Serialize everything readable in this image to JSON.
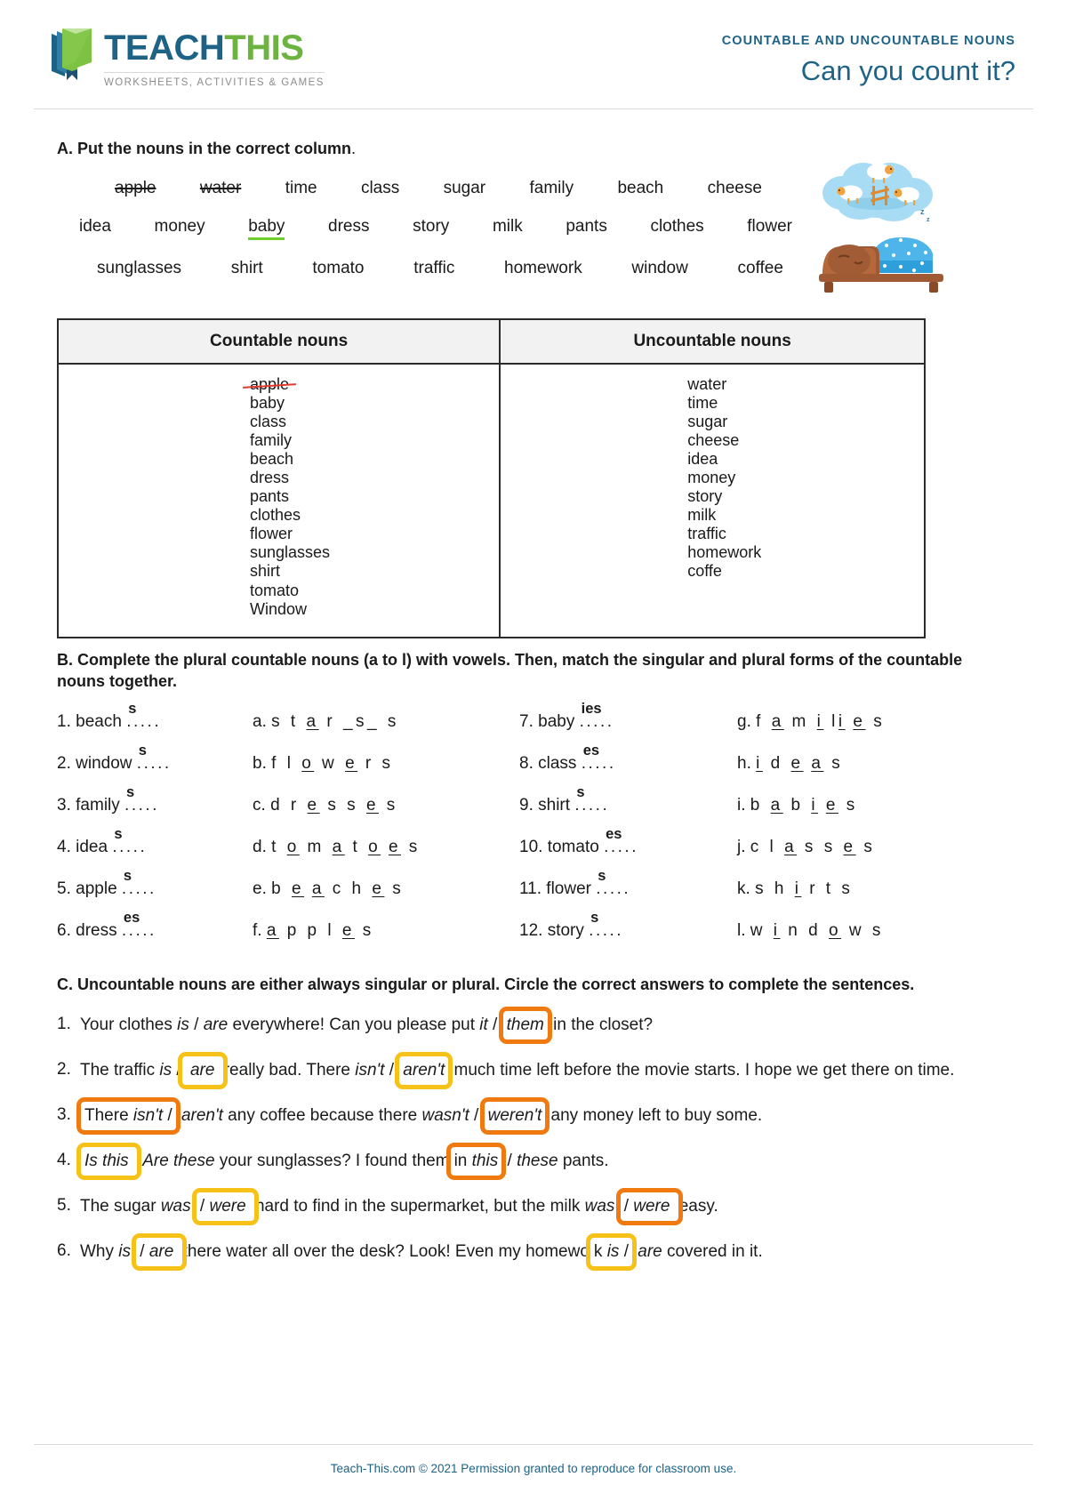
{
  "header": {
    "logo_title_dark": "TEACH",
    "logo_title_green": "THIS",
    "logo_tagline": "WORKSHEETS, ACTIVITIES & GAMES",
    "kicker": "COUNTABLE AND UNCOUNTABLE NOUNS",
    "title": "Can you count it?",
    "brand_dark": "#1e6386",
    "brand_green": "#6cb33f"
  },
  "section_a": {
    "heading_bold": "A. Put the nouns in the correct column",
    "heading_tail": ".",
    "word_bank_rows": [
      [
        {
          "word": "apple",
          "style": "struck"
        },
        {
          "word": "water",
          "style": "struck"
        },
        {
          "word": "time",
          "style": "plain"
        },
        {
          "word": "class",
          "style": "plain"
        },
        {
          "word": "sugar",
          "style": "plain"
        },
        {
          "word": "family",
          "style": "plain"
        },
        {
          "word": "beach",
          "style": "plain"
        },
        {
          "word": "cheese",
          "style": "plain"
        }
      ],
      [
        {
          "word": "idea",
          "style": "plain"
        },
        {
          "word": "money",
          "style": "plain"
        },
        {
          "word": "baby",
          "style": "under-green"
        },
        {
          "word": "dress",
          "style": "plain"
        },
        {
          "word": "story",
          "style": "plain"
        },
        {
          "word": "milk",
          "style": "plain"
        },
        {
          "word": "pants",
          "style": "plain"
        },
        {
          "word": "clothes",
          "style": "plain"
        },
        {
          "word": "flower",
          "style": "plain"
        }
      ],
      [
        {
          "word": "sunglasses",
          "style": "plain"
        },
        {
          "word": "shirt",
          "style": "plain"
        },
        {
          "word": "tomato",
          "style": "plain"
        },
        {
          "word": "traffic",
          "style": "plain"
        },
        {
          "word": "homework",
          "style": "plain"
        },
        {
          "word": "window",
          "style": "plain"
        },
        {
          "word": "coffee",
          "style": "plain"
        }
      ]
    ],
    "illustration_name": "sleeping-person-counting-sheep",
    "table": {
      "headers": [
        "Countable nouns",
        "Uncountable nouns"
      ],
      "countable": [
        {
          "word": "apple",
          "struck": true
        },
        {
          "word": "baby",
          "struck": false
        },
        {
          "word": "class",
          "struck": false
        },
        {
          "word": "family",
          "struck": false
        },
        {
          "word": "beach",
          "struck": false
        },
        {
          "word": "dress",
          "struck": false
        },
        {
          "word": "pants",
          "struck": false
        },
        {
          "word": "clothes",
          "struck": false
        },
        {
          "word": "flower",
          "struck": false
        },
        {
          "word": "sunglasses",
          "struck": false
        },
        {
          "word": "shirt",
          "struck": false
        },
        {
          "word": "tomato",
          "struck": false
        },
        {
          "word": "Window",
          "struck": false
        }
      ],
      "uncountable": [
        {
          "word": "water",
          "struck": false
        },
        {
          "word": "time",
          "struck": false
        },
        {
          "word": "sugar",
          "struck": false
        },
        {
          "word": "cheese",
          "struck": false
        },
        {
          "word": "idea",
          "struck": false
        },
        {
          "word": "money",
          "struck": false
        },
        {
          "word": "story",
          "struck": false
        },
        {
          "word": "milk",
          "struck": false
        },
        {
          "word": "traffic",
          "struck": false
        },
        {
          "word": "homework",
          "struck": false
        },
        {
          "word": "coffe",
          "struck": false
        }
      ]
    }
  },
  "section_b": {
    "heading": "B. Complete the plural countable nouns (a to l) with vowels. Then, match the singular and plural forms of the countable nouns together.",
    "numbered": [
      {
        "n": "1.",
        "word": "beach",
        "answer": "s"
      },
      {
        "n": "2.",
        "word": "window",
        "answer": "s"
      },
      {
        "n": "3.",
        "word": "family",
        "answer": "s"
      },
      {
        "n": "4.",
        "word": "idea",
        "answer": "s"
      },
      {
        "n": "5.",
        "word": "apple",
        "answer": "s"
      },
      {
        "n": "6.",
        "word": "dress",
        "answer": "es"
      },
      {
        "n": "7.",
        "word": "baby",
        "answer": "ies"
      },
      {
        "n": "8.",
        "word": "class",
        "answer": "es"
      },
      {
        "n": "9.",
        "word": "shirt",
        "answer": "s"
      },
      {
        "n": "10.",
        "word": "tomato",
        "answer": "es"
      },
      {
        "n": "11.",
        "word": "flower",
        "answer": "s"
      },
      {
        "n": "12.",
        "word": "story",
        "answer": "s"
      }
    ],
    "lettered": [
      {
        "n": "a.",
        "letters": "s t a r _s_ s",
        "vowels": "a"
      },
      {
        "n": "b.",
        "letters": "f l o w e r s",
        "vowels": "o,e"
      },
      {
        "n": "c.",
        "letters": "d r e s s e s",
        "vowels": "e,e"
      },
      {
        "n": "d.",
        "letters": "t o m a t o e s",
        "vowels": "o,a,o,e"
      },
      {
        "n": "e.",
        "letters": "b e a c h e s",
        "vowels": "e,a,e"
      },
      {
        "n": "f.",
        "letters": "a p p l e s",
        "vowels": "a,e"
      },
      {
        "n": "g.",
        "letters": "f a m i l i e s",
        "vowels": "a,i,i,e"
      },
      {
        "n": "h.",
        "letters": "i d e a s",
        "vowels": "i,e,a"
      },
      {
        "n": "i.",
        "letters": "b a b i e s",
        "vowels": "a,i,e"
      },
      {
        "n": "j.",
        "letters": "c l a s s e s",
        "vowels": "a,e"
      },
      {
        "n": "k.",
        "letters": "s h i r t s",
        "vowels": "i"
      },
      {
        "n": "l.",
        "letters": "w i n d o w s",
        "vowels": "i,o"
      }
    ]
  },
  "section_c": {
    "heading": "C. Uncountable nouns are either always singular or plural. Circle the correct answers to complete the sentences.",
    "items": [
      {
        "n": "1.",
        "text": "Your clothes is / are everywhere! Can you please put it / them in the closet?",
        "circled": [
          "them"
        ]
      },
      {
        "n": "2.",
        "text": "The traffic is / are really bad. There isn't / aren't much time left before the movie starts. I hope we get there on time.",
        "circled": [
          "are",
          "aren't"
        ]
      },
      {
        "n": "3.",
        "text": "There isn't / aren't any coffee because there wasn't / weren't any money left to buy some.",
        "circled": [
          "isn't",
          "weren't"
        ]
      },
      {
        "n": "4.",
        "text": "Is this / Are these your sunglasses? I found them in this / these pants.",
        "circled": [
          "Is this",
          "in this"
        ]
      },
      {
        "n": "5.",
        "text": "The sugar was / were hard to find in the supermarket, but the milk was / were easy.",
        "circled": [
          "were",
          "were"
        ]
      },
      {
        "n": "6.",
        "text": "Why is / are there water all over the desk? Look! Even my homework is / are covered in it.",
        "circled": [
          "is / are",
          "k is /"
        ]
      }
    ],
    "highlight_orange": "#f07a10",
    "highlight_yellow": "#f6c217"
  },
  "footer": {
    "text": "Teach-This.com © 2021 Permission granted to reproduce for classroom use."
  }
}
